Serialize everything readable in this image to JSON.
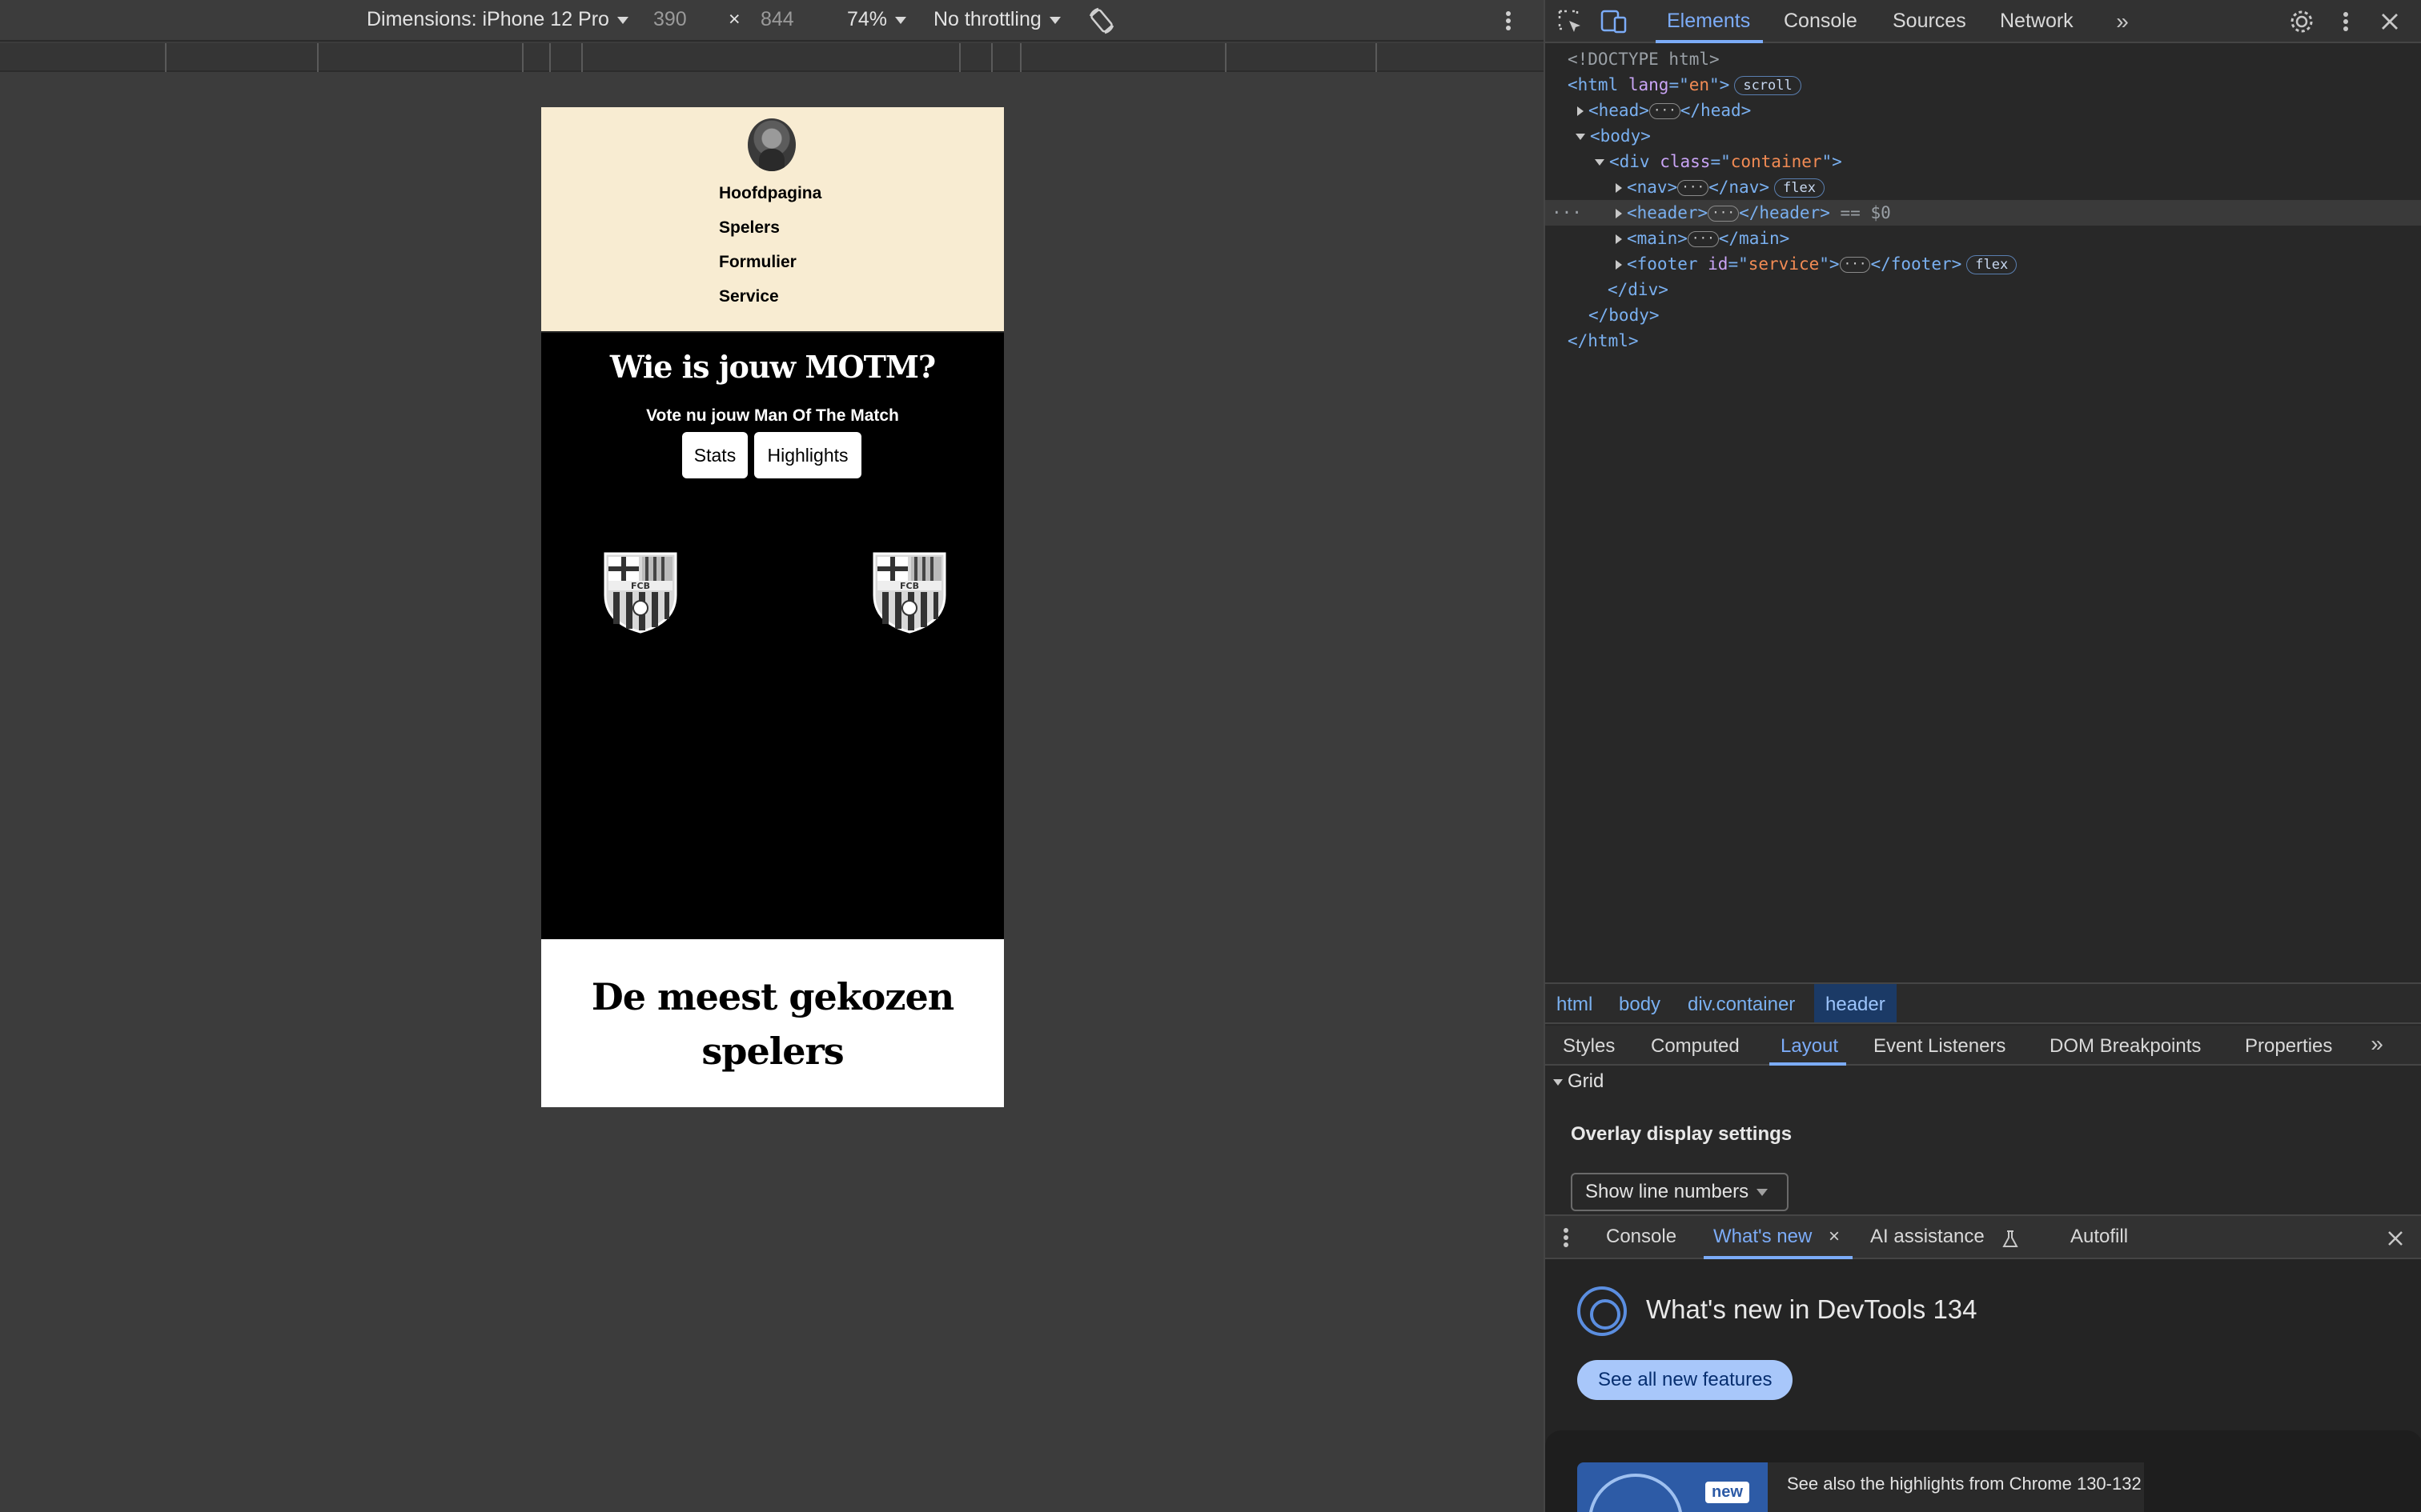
{
  "device_toolbar": {
    "dimensions_label": "Dimensions: iPhone 12 Pro",
    "width": "390",
    "times": "×",
    "height": "844",
    "zoom": "74%",
    "throttling": "No throttling"
  },
  "site": {
    "nav_links": [
      "Hoofdpagina",
      "Spelers",
      "Formulier",
      "Service"
    ],
    "hero_title": "Wie is jouw MOTM?",
    "hero_subtitle": "Vote nu jouw Man Of The Match",
    "buttons": [
      "Stats",
      "Highlights"
    ],
    "crest_text": "FCB",
    "main_title": "De meest gekozen spelers"
  },
  "devtools": {
    "tabs": [
      "Elements",
      "Console",
      "Sources",
      "Network"
    ],
    "dom": {
      "doctype": "<!DOCTYPE html>",
      "html_lang": "en",
      "scroll_badge": "scroll",
      "flex_badge": "flex",
      "ellipsis": "···",
      "div_class": "container",
      "footer_id": "service",
      "selected_marker": "== $0"
    },
    "breadcrumbs": [
      "html",
      "body",
      "div.container",
      "header"
    ],
    "sub_tabs": [
      "Styles",
      "Computed",
      "Layout",
      "Event Listeners",
      "DOM Breakpoints",
      "Properties"
    ],
    "grid_label": "Grid",
    "overlay_label": "Overlay display settings",
    "show_line_numbers": "Show line numbers",
    "drawer_tabs": [
      "Console",
      "What's new",
      "AI assistance",
      "Autofill"
    ],
    "whats_new_title": "What's new in DevTools 134",
    "see_all": "See all new features",
    "new_badge": "new",
    "highlight_text": "See also the highlights from Chrome 130-132"
  },
  "colors": {
    "nav_bg": "#f8ecd2",
    "accent": "#7cacf8",
    "hero_bg": "#000000"
  }
}
